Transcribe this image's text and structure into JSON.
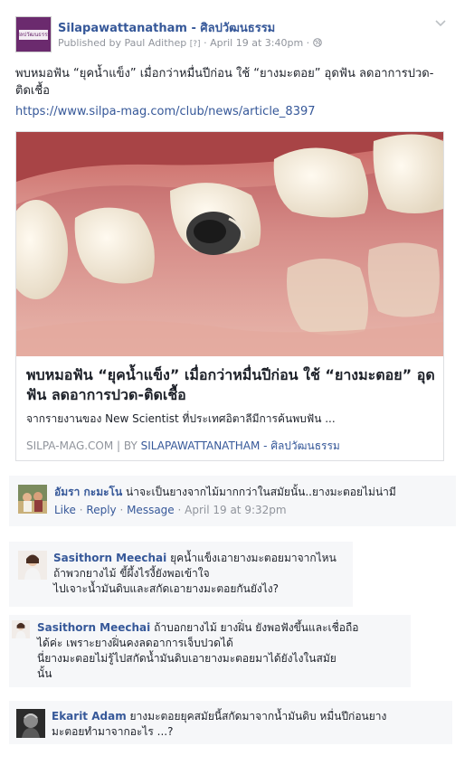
{
  "post": {
    "page_name": "Silapawattanatham - ศิลปวัฒนธรรม",
    "avatar_text": "ศิลปวัฒนธรรม",
    "published_by_prefix": "Published by ",
    "publisher": "Paul Adithep",
    "publisher_tag": "[?]",
    "sep": " · ",
    "date": "April 19 at 3:40pm",
    "privacy_icon": "globe-icon",
    "text": "พบหมอฟัน “ยุคน้ำแข็ง” เมื่อกว่าหมื่นปีก่อน ใช้ “ยางมะตอย” อุดฟัน ลดอาการปวด-ติดเชื้อ",
    "link": "https://www.silpa-mag.com/club/news/article_8397"
  },
  "card": {
    "title": "พบหมอฟัน “ยุคน้ำแข็ง” เมื่อกว่าหมื่นปีก่อน ใช้ “ยางมะตอย” อุดฟัน ลดอาการปวด-ติดเชื้อ",
    "description": "จากรายงานของ New Scientist ที่ประเทศอิตาลีมีการค้นพบฟัน ...",
    "domain": "SILPA-MAG.COM",
    "by_label": " | BY ",
    "author": "SILAPAWATTANATHAM - ศิลปวัฒนธรรม"
  },
  "comments": [
    {
      "name": "อัมรา กะมะโน",
      "text": "น่าจะเป็นยางจากไม้มากกว่าในสมัยนั้น..ยางมะตอยไม่น่ามี",
      "like": "Like",
      "reply": "Reply",
      "message": "Message",
      "time": "April 19 at 9:32pm"
    },
    {
      "name": "Sasithorn Meechai",
      "line1": "ยุคน้ำแข็งเอายางมะตอยมาจากไหน",
      "line2": "ถ้าพวกยางไม้ ขี้ผึ้งไรงี้ยังพอเข้าใจ",
      "line3": "ไปเจาะน้ำมันดิบและสกัดเอายางมะตอยกันยังไง?"
    },
    {
      "name": "Sasithorn Meechai",
      "line1": "ถ้าบอกยางไม้ ยางฝิ่น ยังพอฟังขึ้นและเชื่อถือ",
      "line2": "ได้ค่ะ เพราะยางฝิ่นคงลดอาการเจ็บปวดได้",
      "line3": "นี่ยางมะตอยไม่รู้ไปสกัดน้ำมันดิบเอายางมะตอยมาได้ยังไงในสมัย",
      "line4": "นั้น"
    },
    {
      "name": "Ekarit Adam",
      "line1": "ยางมะตอยยุคสมัยนี้สกัดมาจากน้ำมันดิบ หมื่นปีก่อนยาง",
      "line2": "มะตอยทำมาจากอะไร ...?"
    }
  ],
  "colors": {
    "link": "#365899",
    "meta": "#90949c",
    "comment_bg": "#f6f7f9",
    "brand": "#6b2a6e"
  }
}
